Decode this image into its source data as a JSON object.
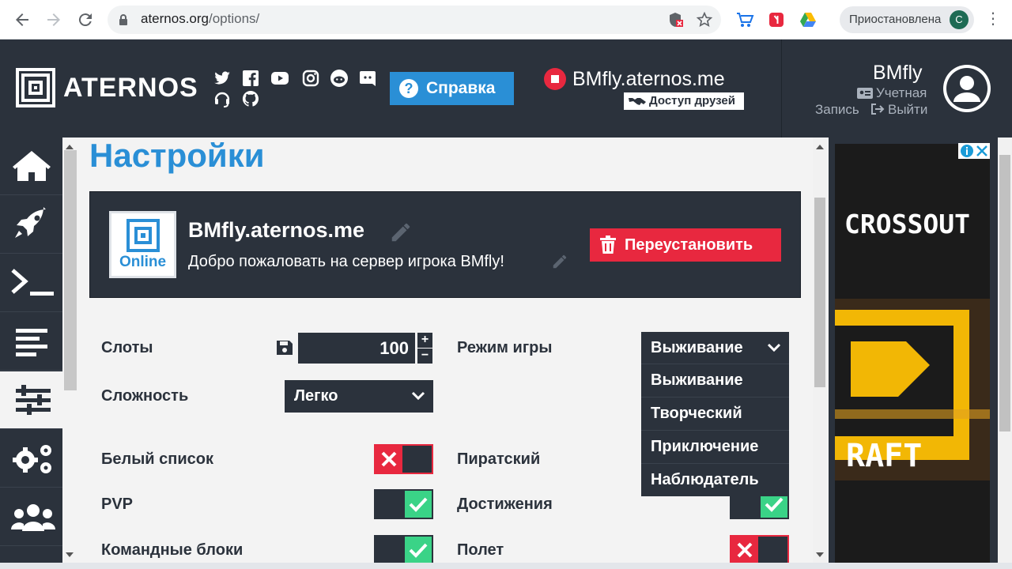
{
  "browser": {
    "url_host": "aternos.org",
    "url_path": "/options/",
    "profile_status": "Приостановлена",
    "profile_initial": "C"
  },
  "header": {
    "logo_text": "ATERNOS",
    "help_label": "Справка",
    "server_address": "BMfly.aternos.me",
    "friends_access": "Доступ друзей",
    "username": "BMfly",
    "account_label": "Учетная",
    "account_label2": "Запись",
    "logout_label": "Выйти"
  },
  "page": {
    "title": "Настройки",
    "server_status": "Online",
    "server_address": "BMfly.aternos.me",
    "motd": "Добро пожаловать на сервер игрока BMfly!",
    "reinstall_label": "Переустановить"
  },
  "options": {
    "slots_label": "Слоты",
    "slots_value": "100",
    "difficulty_label": "Сложность",
    "difficulty_value": "Легко",
    "gamemode_label": "Режим игры",
    "gamemode_value": "Выживание",
    "gamemode_options": [
      "Выживание",
      "Творческий",
      "Приключение",
      "Наблюдатель"
    ],
    "whitelist_label": "Белый список",
    "whitelist_on": false,
    "cracked_label": "Пиратский",
    "pvp_label": "PVP",
    "pvp_on": true,
    "achievements_label": "Достижения",
    "achievements_on": true,
    "commandblocks_label": "Командные блоки",
    "commandblocks_on": true,
    "flight_label": "Полет",
    "flight_on": false
  },
  "ad": {
    "brand": "CROSSOUT",
    "subtext": "RAFT"
  },
  "colors": {
    "accent_blue": "#2a8fd6",
    "danger_red": "#e8283f",
    "success_green": "#3ad387",
    "dark_bg": "#2b323c"
  }
}
